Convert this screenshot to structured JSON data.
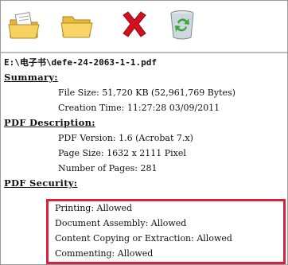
{
  "toolbar": {
    "buttons": [
      {
        "name": "open-file-icon"
      },
      {
        "name": "open-folder-icon"
      },
      {
        "name": "remove-icon"
      },
      {
        "name": "recycle-bin-icon"
      }
    ]
  },
  "file": {
    "path": "E:\\电子书\\defe-24-2063-1-1.pdf"
  },
  "summary": {
    "heading": "Summary:",
    "file_size": "File Size: 51,720 KB (52,961,769 Bytes)",
    "creation_time": "Creation Time: 11:27:28 03/09/2011"
  },
  "pdf_description": {
    "heading": "PDF Description:",
    "version": "PDF Version: 1.6 (Acrobat 7.x)",
    "page_size": "Page Size: 1632 x 2111 Pixel",
    "pages": "Number of Pages: 281"
  },
  "pdf_security": {
    "heading": "PDF Security:",
    "printing": "Printing: Allowed",
    "document_assembly": "Document Assembly: Allowed",
    "content_copying": "Content Copying or Extraction: Allowed",
    "commenting": "Commenting: Allowed"
  },
  "colors": {
    "highlight": "#d6223a",
    "folder": "#f3c94a",
    "remove": "#d4101f",
    "recycle": "#3ea63a"
  }
}
